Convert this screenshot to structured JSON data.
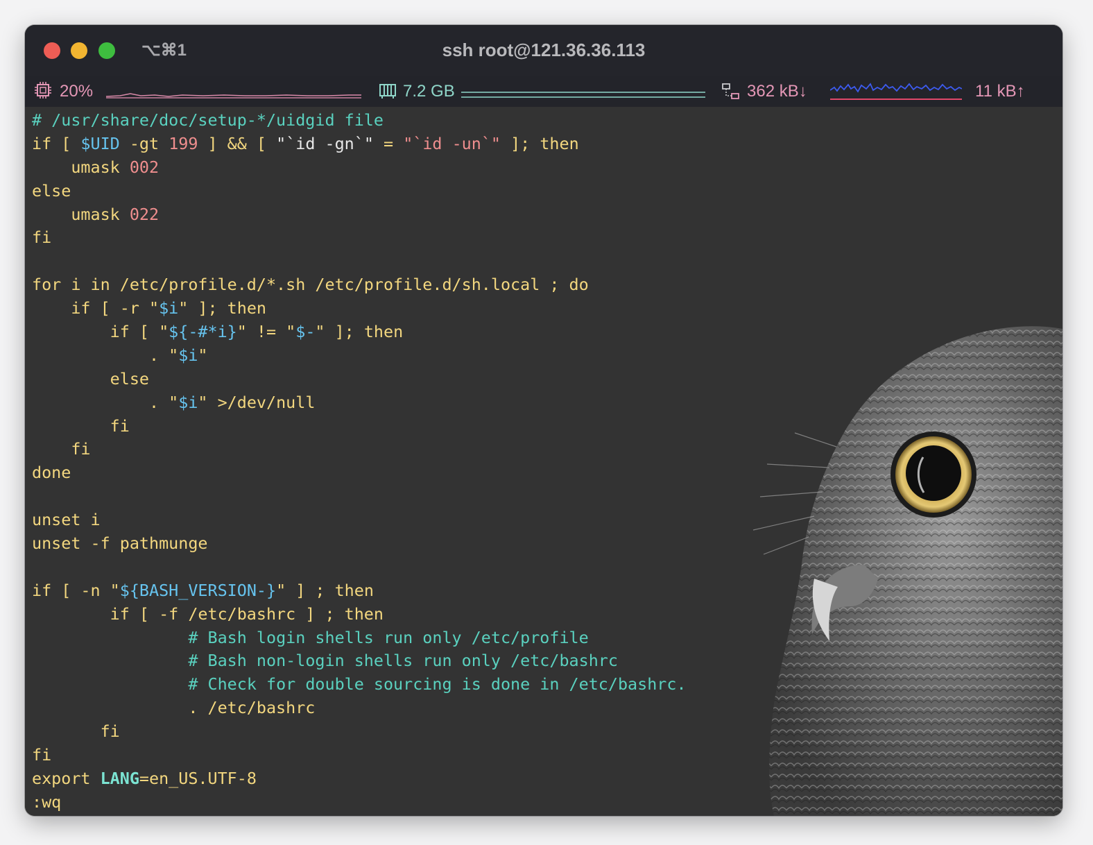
{
  "window": {
    "title": "ssh root@121.36.36.113",
    "tab_shortcut": "⌥⌘1"
  },
  "status": {
    "cpu": "20%",
    "memory": "7.2 GB",
    "net_down": "362 kB↓",
    "net_up": "11 kB↑"
  },
  "colors": {
    "comment": "#5ad1bf",
    "variable": "#66c3ee",
    "number": "#ef8e8e",
    "text": "#f3d77f",
    "background": "#333333"
  },
  "icons": [
    "cpu-icon",
    "memory-icon",
    "network-icon",
    "owl-wallpaper"
  ],
  "editor": {
    "lines": [
      [
        {
          "t": "# /usr/share/doc/setup-*/uidgid file",
          "c": "com"
        }
      ],
      [
        {
          "t": "if [ ",
          "c": "kw"
        },
        {
          "t": "$UID",
          "c": "var"
        },
        {
          "t": " -gt ",
          "c": "kw"
        },
        {
          "t": "199",
          "c": "num"
        },
        {
          "t": " ] && [ ",
          "c": "kw"
        },
        {
          "t": "\"`id -gn`\"",
          "c": "white"
        },
        {
          "t": " = ",
          "c": "kw"
        },
        {
          "t": "\"`id -un`\"",
          "c": "str"
        },
        {
          "t": " ]; then",
          "c": "kw"
        }
      ],
      [
        {
          "t": "    umask ",
          "c": "kw"
        },
        {
          "t": "002",
          "c": "num"
        }
      ],
      [
        {
          "t": "else",
          "c": "kw"
        }
      ],
      [
        {
          "t": "    umask ",
          "c": "kw"
        },
        {
          "t": "022",
          "c": "num"
        }
      ],
      [
        {
          "t": "fi",
          "c": "kw"
        }
      ],
      [
        {
          "t": "",
          "c": "kw"
        }
      ],
      [
        {
          "t": "for i in /etc/profile.d/*.sh /etc/profile.d/sh.local ; do",
          "c": "kw"
        }
      ],
      [
        {
          "t": "    if [ -r \"",
          "c": "kw"
        },
        {
          "t": "$i",
          "c": "var"
        },
        {
          "t": "\" ]; then",
          "c": "kw"
        }
      ],
      [
        {
          "t": "        if [ \"",
          "c": "kw"
        },
        {
          "t": "${-#*i}",
          "c": "var"
        },
        {
          "t": "\" != \"",
          "c": "kw"
        },
        {
          "t": "$-",
          "c": "var"
        },
        {
          "t": "\" ]; then",
          "c": "kw"
        }
      ],
      [
        {
          "t": "            . \"",
          "c": "kw"
        },
        {
          "t": "$i",
          "c": "var"
        },
        {
          "t": "\"",
          "c": "kw"
        }
      ],
      [
        {
          "t": "        else",
          "c": "kw"
        }
      ],
      [
        {
          "t": "            . \"",
          "c": "kw"
        },
        {
          "t": "$i",
          "c": "var"
        },
        {
          "t": "\" >/dev/null",
          "c": "kw"
        }
      ],
      [
        {
          "t": "        fi",
          "c": "kw"
        }
      ],
      [
        {
          "t": "    fi",
          "c": "kw"
        }
      ],
      [
        {
          "t": "done",
          "c": "kw"
        }
      ],
      [
        {
          "t": "",
          "c": "kw"
        }
      ],
      [
        {
          "t": "unset i",
          "c": "kw"
        }
      ],
      [
        {
          "t": "unset -f pathmunge",
          "c": "kw"
        }
      ],
      [
        {
          "t": "",
          "c": "kw"
        }
      ],
      [
        {
          "t": "if [ -n \"",
          "c": "kw"
        },
        {
          "t": "${BASH_VERSION-}",
          "c": "var"
        },
        {
          "t": "\" ] ; then",
          "c": "kw"
        }
      ],
      [
        {
          "t": "        if [ -f /etc/bashrc ] ; then",
          "c": "kw"
        }
      ],
      [
        {
          "t": "                ",
          "c": "kw"
        },
        {
          "t": "# Bash login shells run only /etc/profile",
          "c": "com"
        }
      ],
      [
        {
          "t": "                ",
          "c": "kw"
        },
        {
          "t": "# Bash non-login shells run only /etc/bashrc",
          "c": "com"
        }
      ],
      [
        {
          "t": "                ",
          "c": "kw"
        },
        {
          "t": "# Check for double sourcing is done in /etc/bashrc.",
          "c": "com"
        }
      ],
      [
        {
          "t": "                . /etc/bashrc",
          "c": "kw"
        }
      ],
      [
        {
          "t": "       fi",
          "c": "kw"
        }
      ],
      [
        {
          "t": "fi",
          "c": "kw"
        }
      ],
      [
        {
          "t": "export ",
          "c": "kw"
        },
        {
          "t": "LANG",
          "c": "lang"
        },
        {
          "t": "=en_US.UTF-8",
          "c": "kw"
        }
      ],
      [
        {
          "t": ":wq",
          "c": "kw"
        }
      ]
    ]
  }
}
